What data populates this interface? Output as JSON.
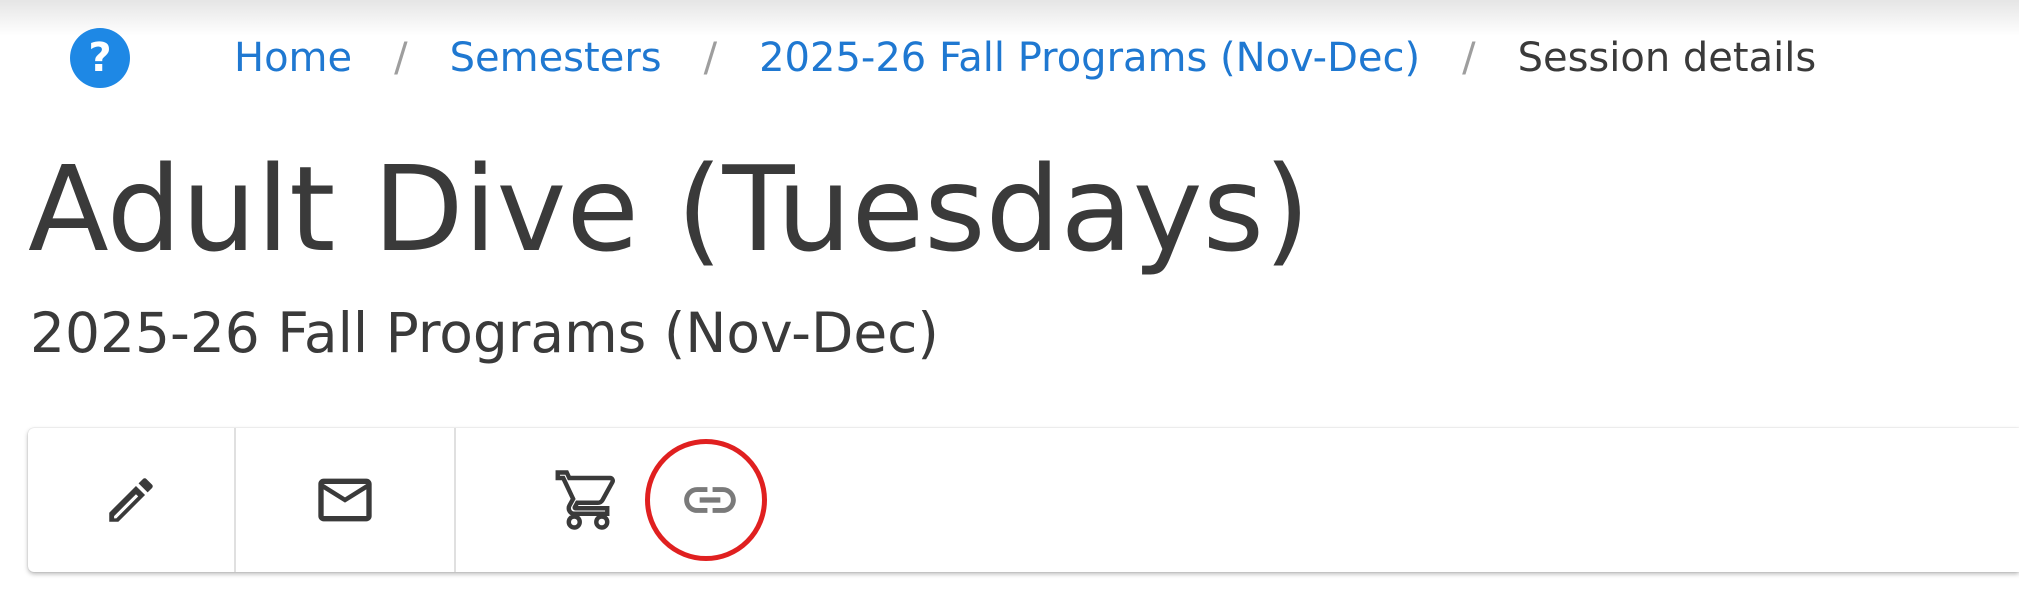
{
  "help": {
    "icon": "help-circle-icon",
    "glyph": "?",
    "color": "#1e88e5"
  },
  "breadcrumb": {
    "items": [
      {
        "label": "Home"
      },
      {
        "label": "Semesters"
      },
      {
        "label": "2025-26 Fall Programs (Nov-Dec)"
      }
    ],
    "separator": "/",
    "current": "Session details",
    "link_color": "#1f78d1"
  },
  "page": {
    "title": "Adult Dive (Tuesdays)",
    "subtitle": "2025-26 Fall Programs (Nov-Dec)"
  },
  "toolbar": {
    "actions": [
      {
        "name": "edit",
        "icon": "pencil-icon"
      },
      {
        "name": "email",
        "icon": "envelope-icon"
      },
      {
        "name": "cart",
        "icon": "cart-icon"
      },
      {
        "name": "link",
        "icon": "link-icon",
        "highlighted": true
      }
    ],
    "highlight_color": "#e02020"
  }
}
